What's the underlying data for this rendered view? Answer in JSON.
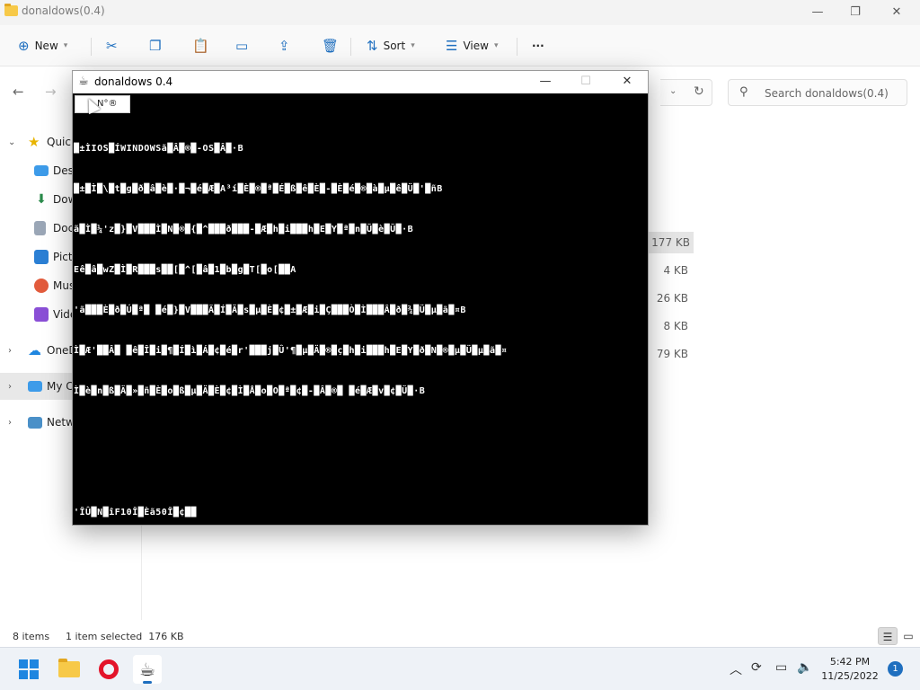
{
  "explorer": {
    "title": "donaldows(0.4)",
    "toolbar": {
      "new_label": "New",
      "sort_label": "Sort",
      "view_label": "View",
      "more_label": "···"
    },
    "search_placeholder": "Search donaldows(0.4)",
    "sidebar": [
      {
        "label": "Quick",
        "icon": "star-icon",
        "expanded": true
      },
      {
        "label": "Desk",
        "icon": "desktop-icon"
      },
      {
        "label": "Dow",
        "icon": "download-icon"
      },
      {
        "label": "Doc",
        "icon": "document-icon"
      },
      {
        "label": "Pict",
        "icon": "pictures-icon"
      },
      {
        "label": "Mus",
        "icon": "music-icon"
      },
      {
        "label": "Vide",
        "icon": "video-icon"
      },
      {
        "label": "OneD",
        "icon": "cloud-icon"
      },
      {
        "label": "My C",
        "icon": "computer-icon",
        "selected": true
      },
      {
        "label": "Netw",
        "icon": "network-icon"
      }
    ],
    "file_sizes": [
      "177 KB",
      "4 KB",
      "26 KB",
      "8 KB",
      "79 KB"
    ],
    "status": {
      "items": "8 items",
      "selection": "1 item selected  176 KB"
    }
  },
  "console": {
    "title": "donaldows 0.4",
    "menu_label": "N°®",
    "lines": [
      "█±ÌIOS█ÍWINDOWSã█Â█®█-OS█Â█·B",
      "█±█Ì█\\█t█g█ð█â█è█·█¬█é█Æ█A³í█È█®█ª█É█ß█ê█È█-█È█é█®█à█µ█ê█Ü█'█ñB",
      "ã█Ì█¼'z█}█V███Ì█N█®█{█^███ð███-█Æ█h█i███h█E█Y█ª█n█Ü█è█Ü█·B",
      "Eê█â█wZ█Ì█R███s██[█^[█â█1█b█g█T[█o[██A",
      "'ã███È█ð█Ú█ª█ █é█}█V███Ã█Í█Ä█s█µ█È█¢█±█Æ█i█Ç███Ò█Ì███Â█ð█¾█Ü█µ█ã█¤B",
      "Ì█Æ'██Â█ █ê█Î█i█¶█Í█ì█Á█¢█é█r'███j█Û'¶█µ█Ä█®█ç█h█i███h█E█Y█ð█N█®█µ█Ü█µ█ã█¤",
      "Ì█è█n█ß█Ä█»█ñ█È█o█ß█µ█Ä█È█¢█Ì█Å█o█O█ª█¢█-█Â█®█ █é█Æ█v█¢█Ü█·B",
      "",
      "",
      "'ÎÛ█N█îF10Î█Èã50Î█¢██"
    ]
  },
  "taskbar": {
    "time": "5:42 PM",
    "date": "11/25/2022",
    "notification_count": "1",
    "accent": "#1f6fbf"
  }
}
